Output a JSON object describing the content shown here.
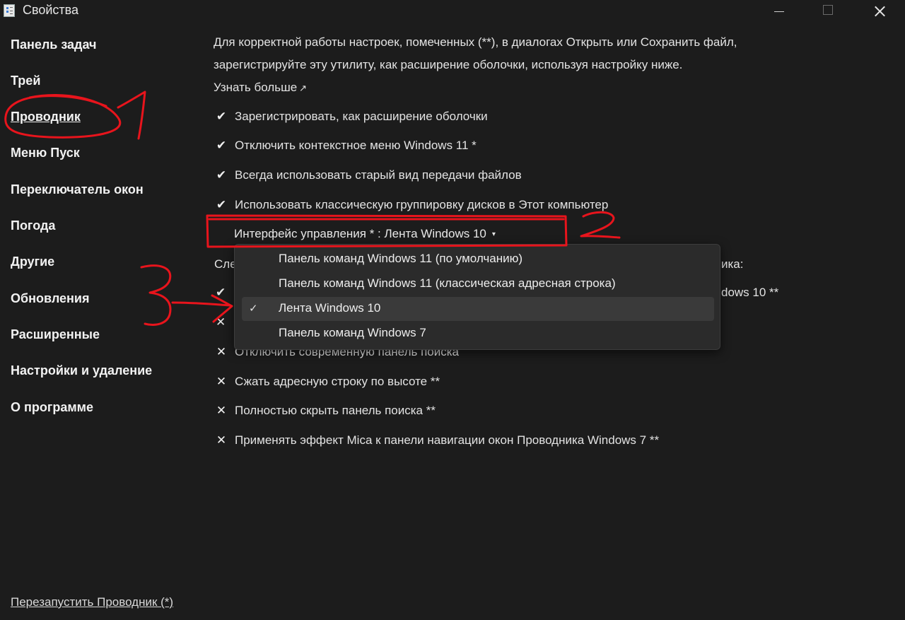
{
  "window": {
    "title": "Свойства"
  },
  "sidebar": {
    "items": [
      {
        "label": "Панель задач"
      },
      {
        "label": "Трей"
      },
      {
        "label": "Проводник"
      },
      {
        "label": "Меню Пуск"
      },
      {
        "label": "Переключатель окон"
      },
      {
        "label": "Погода"
      },
      {
        "label": "Другие"
      },
      {
        "label": "Обновления"
      },
      {
        "label": "Расширенные"
      },
      {
        "label": "Настройки и удаление"
      },
      {
        "label": "О программе"
      }
    ],
    "selected": "Проводник",
    "restart_link": "Перезапустить Проводник (*)"
  },
  "content": {
    "info_line1": "Для корректной работы настроек, помеченных (**), в диалогах Открыть или Сохранить файл,",
    "info_line2": "зарегистрируйте эту утилиту, как расширение оболочки, используя настройку ниже.",
    "learn_more": "Узнать больше",
    "learn_more_icon": "↗",
    "options_top": [
      {
        "label": "Зарегистрировать, как расширение оболочки",
        "checked": true,
        "mark": "✔"
      },
      {
        "label": "Отключить контекстное меню Windows 11 *",
        "checked": true,
        "mark": "✔"
      },
      {
        "label": "Всегда использовать старый вид передачи файлов",
        "checked": true,
        "mark": "✔"
      },
      {
        "label": "Использовать классическую группировку дисков в Этот компьютер",
        "checked": true,
        "mark": "✔"
      }
    ],
    "ribbon": {
      "label": "Интерфейс управления * : ",
      "value": "Лента Windows 10",
      "caret": "▾"
    },
    "hidden_fragments": {
      "left": "Сле",
      "right_colon": "ика:",
      "right_win10": "dows 10 **"
    },
    "hidden_marks": [
      "✔",
      "✕"
    ],
    "options_bottom": [
      {
        "label": "Отключить современную панель поиска",
        "checked": false,
        "mark": "✕"
      },
      {
        "label": "Сжать адресную строку по высоте **",
        "checked": false,
        "mark": "✕"
      },
      {
        "label": "Полностью скрыть панель поиска **",
        "checked": false,
        "mark": "✕"
      },
      {
        "label": "Применять эффект Mica к панели навигации окон Проводника Windows 7 **",
        "checked": false,
        "mark": "✕"
      }
    ]
  },
  "dropdown": {
    "check_mark": "✓",
    "options": [
      {
        "label": "Панель команд Windows 11 (по умолчанию)",
        "selected": false
      },
      {
        "label": "Панель команд Windows 11 (классическая адресная строка)",
        "selected": false
      },
      {
        "label": "Лента Windows 10",
        "selected": true
      },
      {
        "label": "Панель команд Windows 7",
        "selected": false
      }
    ]
  },
  "colors": {
    "background": "#1c1c1c",
    "dropdown_bg": "#2b2b2b",
    "annotation_red": "#e8141c"
  }
}
